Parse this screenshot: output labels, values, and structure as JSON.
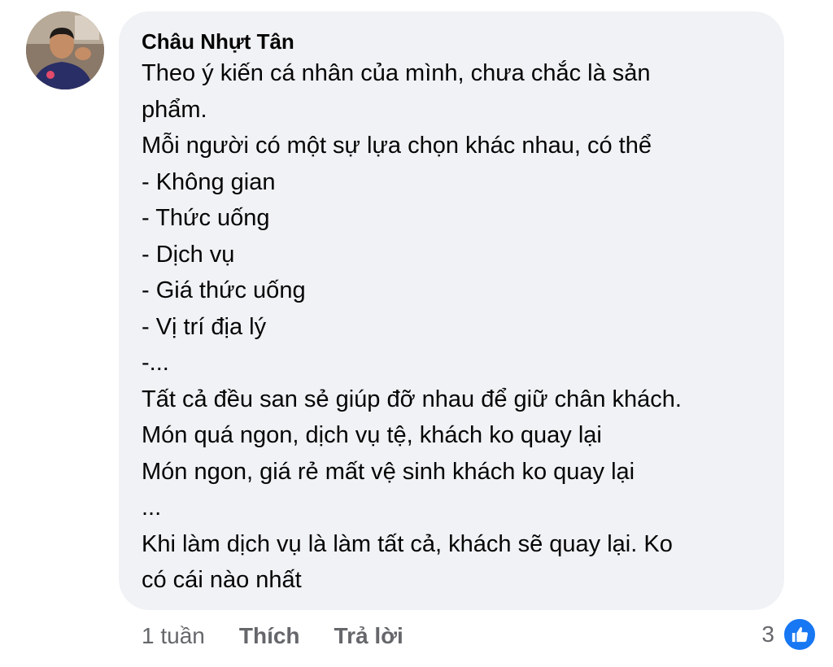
{
  "comment": {
    "author": "Châu Nhựt Tân",
    "lines": [
      "Theo ý kiến cá nhân của mình, chưa chắc là sản",
      "phẩm.",
      "Mỗi người có một sự lựa chọn khác nhau, có thể",
      "- Không gian",
      "- Thức uống",
      "- Dịch vụ",
      "- Giá thức uống",
      "- Vị trí địa lý",
      "-...",
      "Tất cả đều san sẻ giúp đỡ nhau để giữ chân khách.",
      "Món quá ngon, dịch vụ tệ, khách ko quay lại",
      "Món ngon, giá rẻ mất vệ sinh khách ko quay lại",
      "...",
      "Khi làm dịch vụ là làm tất cả, khách sẽ quay lại. Ko",
      "có cái nào nhất"
    ]
  },
  "actions": {
    "time": "1 tuần",
    "like_label": "Thích",
    "reply_label": "Trả lời"
  },
  "reactions": {
    "count": "3",
    "icon": "thumbs-up-icon",
    "color": "#1877f2"
  },
  "colors": {
    "bubble_bg": "#f0f2f5",
    "text": "#050505",
    "secondary_text": "#65676b"
  }
}
